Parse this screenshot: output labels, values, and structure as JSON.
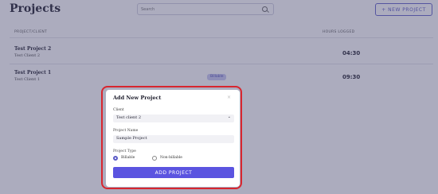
{
  "page": {
    "title": "Projects",
    "search_placeholder": "Search",
    "new_project_label": "+ NEW PROJECT"
  },
  "table": {
    "headers": [
      "PROJECT/CLIENT",
      "HOURS LOGGED"
    ],
    "rows": [
      {
        "project": "Test Project 2",
        "client": "Test Client 2",
        "hours": "04:30",
        "badge": ""
      },
      {
        "project": "Test Project 1",
        "client": "Test Client 1",
        "hours": "09:30",
        "badge": "Billable"
      }
    ]
  },
  "modal": {
    "title": "Add New Project",
    "close_glyph": "×",
    "client_label": "Client",
    "client_value": "Test client 2",
    "name_label": "Project Name",
    "name_value": "Sample Project",
    "type_label": "Project Type",
    "type_options": [
      "Billable",
      "Non-billable"
    ],
    "type_selected": "Billable",
    "submit_label": "ADD PROJECT"
  },
  "colors": {
    "accent": "#5b54e0",
    "highlight_ring": "#d8262f",
    "badge_bg": "#c9c9f2"
  },
  "icons": [
    "search-icon",
    "chevron-down-icon",
    "close-icon"
  ]
}
